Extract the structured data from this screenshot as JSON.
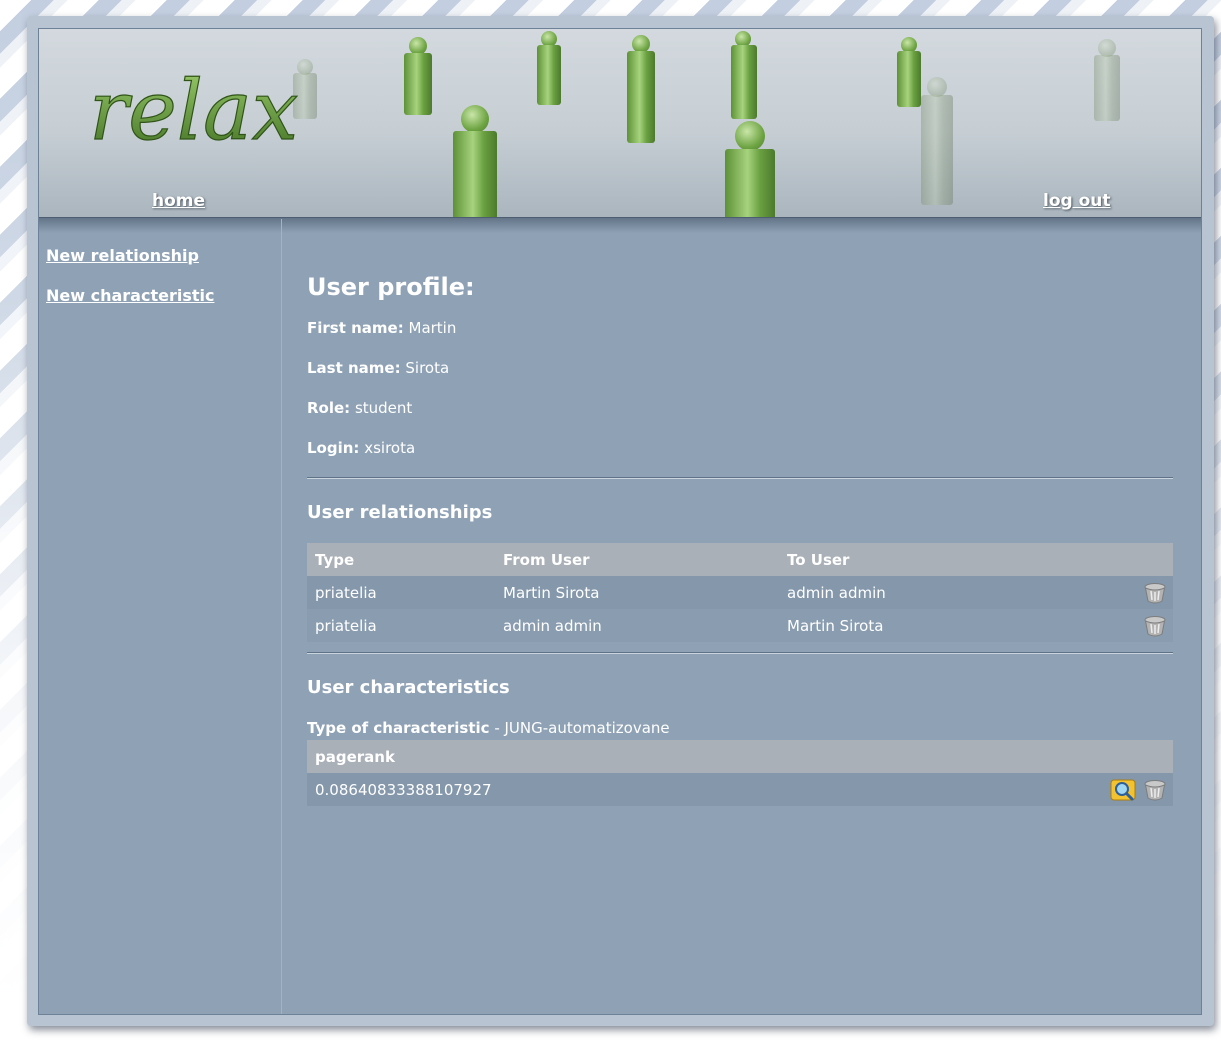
{
  "header": {
    "logo_text": "relax",
    "home_link": "home",
    "logout_link": "log out"
  },
  "sidebar": {
    "items": [
      {
        "label": "New relationship"
      },
      {
        "label": "New characteristic"
      }
    ]
  },
  "profile": {
    "title": "User profile:",
    "fields": [
      {
        "label": "First name:",
        "value": "Martin"
      },
      {
        "label": "Last name:",
        "value": "Sirota"
      },
      {
        "label": "Role:",
        "value": "student"
      },
      {
        "label": "Login:",
        "value": "xsirota"
      }
    ]
  },
  "relationships": {
    "title": "User relationships",
    "columns": [
      "Type",
      "From User",
      "To User"
    ],
    "rows": [
      {
        "type": "priatelia",
        "from": "Martin Sirota",
        "to": "admin admin"
      },
      {
        "type": "priatelia",
        "from": "admin admin",
        "to": "Martin Sirota"
      }
    ]
  },
  "characteristics": {
    "title": "User characteristics",
    "type_label": "Type of characteristic",
    "type_separator": " - ",
    "type_value": "JUNG-automatizovane",
    "column": "pagerank",
    "value": "0.08640833388107927"
  },
  "icons": {
    "delete": "trash-icon",
    "view": "magnifier-icon"
  },
  "colors": {
    "content_bg": "#8fa2b5",
    "table_header_bg": "#a9b0b7",
    "row_bg": "#8497ab",
    "text": "#ffffff",
    "accent_green": "#6ea443"
  }
}
